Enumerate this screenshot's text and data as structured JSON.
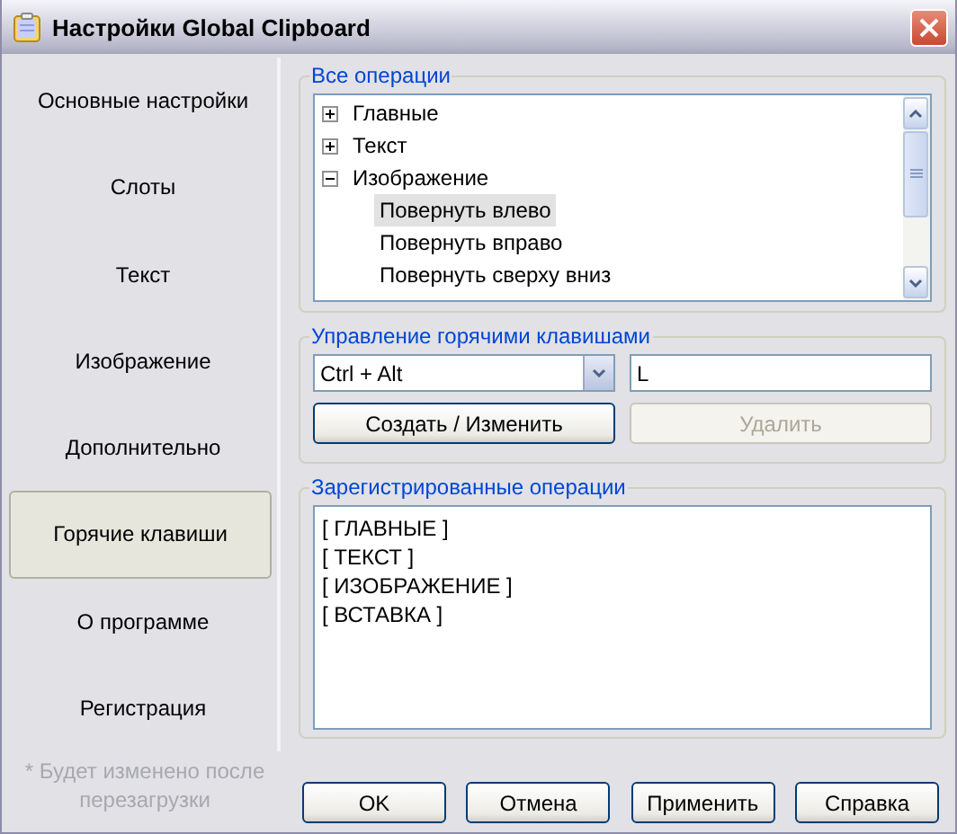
{
  "window": {
    "title": "Настройки Global Clipboard"
  },
  "sidebar": {
    "items": [
      {
        "label": "Основные настройки",
        "selected": false
      },
      {
        "label": "Слоты",
        "selected": false
      },
      {
        "label": "Текст",
        "selected": false
      },
      {
        "label": "Изображение",
        "selected": false
      },
      {
        "label": "Дополнительно",
        "selected": false
      },
      {
        "label": "Горячие клавиши",
        "selected": true
      },
      {
        "label": "О программе",
        "selected": false
      },
      {
        "label": "Регистрация",
        "selected": false
      }
    ],
    "note": "* Будет изменено после перезагрузки"
  },
  "all_operations": {
    "title": "Все операции",
    "tree": [
      {
        "label": "Главные",
        "expanded": false,
        "selected": false
      },
      {
        "label": "Текст",
        "expanded": false,
        "selected": false
      },
      {
        "label": "Изображение",
        "expanded": true,
        "selected": false,
        "children": [
          {
            "label": "Повернуть влево",
            "selected": true
          },
          {
            "label": "Повернуть вправо",
            "selected": false
          },
          {
            "label": "Повернуть сверху вниз",
            "selected": false
          }
        ]
      }
    ]
  },
  "hotkey_management": {
    "title": "Управление горячими клавишами",
    "modifier": "Ctrl + Alt",
    "key": "L",
    "buttons": [
      {
        "label": "Создать / Изменить",
        "disabled": false
      },
      {
        "label": "Удалить",
        "disabled": true
      }
    ]
  },
  "registered_operations": {
    "title": "Зарегистрированные операции",
    "items": [
      "[ ГЛАВНЫЕ ]",
      "[ ТЕКСТ ]",
      "[ ИЗОБРАЖЕНИЕ ]",
      "[ ВСТАВКА ]"
    ]
  },
  "buttons": [
    "OK",
    "Отмена",
    "Применить",
    "Справка"
  ]
}
